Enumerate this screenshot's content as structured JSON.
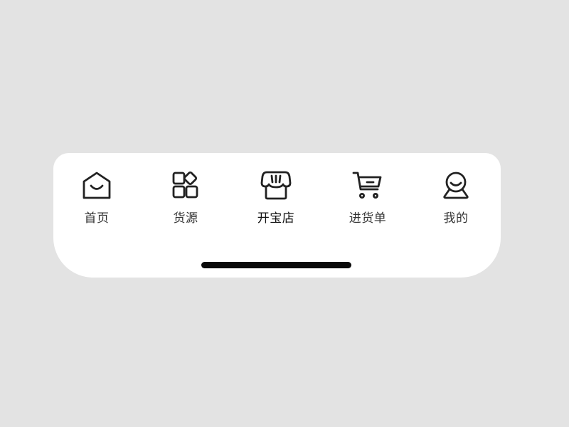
{
  "tabbar": {
    "items": [
      {
        "label": "首页",
        "icon": "home-icon"
      },
      {
        "label": "货源",
        "icon": "categories-icon"
      },
      {
        "label": "开宝店",
        "icon": "shop-icon"
      },
      {
        "label": "进货单",
        "icon": "cart-icon"
      },
      {
        "label": "我的",
        "icon": "profile-icon"
      }
    ],
    "active_index": 2
  },
  "colors": {
    "background": "#e3e3e3",
    "bar": "#ffffff",
    "icon_stroke": "#222222",
    "label": "#333333",
    "home_indicator": "#0a0a0a"
  }
}
